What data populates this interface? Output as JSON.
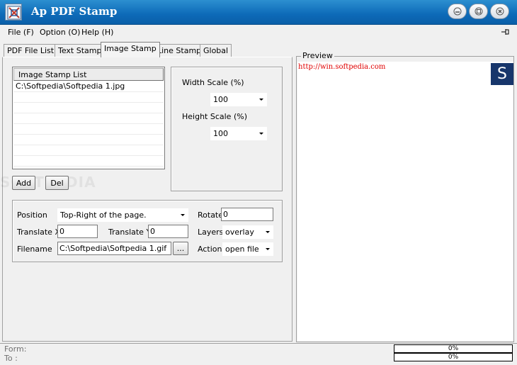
{
  "window": {
    "title": "Ap PDF Stamp"
  },
  "menu": {
    "items": [
      "File (F)",
      "Option (O)",
      "Help (H)"
    ]
  },
  "tabs": [
    "PDF File List",
    "Text Stamp",
    "Image Stamp",
    "Line Stamp",
    "Global"
  ],
  "image_stamp": {
    "list_header": "Image Stamp List",
    "list_items": [
      "C:\\Softpedia\\Softpedia 1.jpg"
    ],
    "add_label": "Add",
    "del_label": "Del",
    "width_scale_label": "Width Scale (%)",
    "width_scale_value": "100",
    "height_scale_label": "Height Scale (%)",
    "height_scale_value": "100",
    "position_label": "Position",
    "position_value": "Top-Right of the page.",
    "rotate_label": "Rotate",
    "rotate_value": "0",
    "translate_x_label": "Translate X",
    "translate_x_value": "0",
    "translate_y_label": "Translate Y",
    "translate_y_value": "0",
    "layers_label": "Layers",
    "layers_value": "overlay",
    "filename_label": "Filename",
    "filename_value": "C:\\Softpedia\\Softpedia 1.gif",
    "browse_label": "...",
    "action_label": "Action",
    "action_value": "open file"
  },
  "preview": {
    "legend": "Preview",
    "url_text": "http://win.softpedia.com",
    "logo_letter": "S"
  },
  "watermark": "SOFTPEDIA",
  "status": {
    "form_label": "Form:",
    "to_label": "To :",
    "progress1": "0%",
    "progress2": "0%"
  },
  "colors": {
    "titlebar": "#0d6ab8",
    "preview_url": "#e00000",
    "logo_bg": "#17366b"
  }
}
